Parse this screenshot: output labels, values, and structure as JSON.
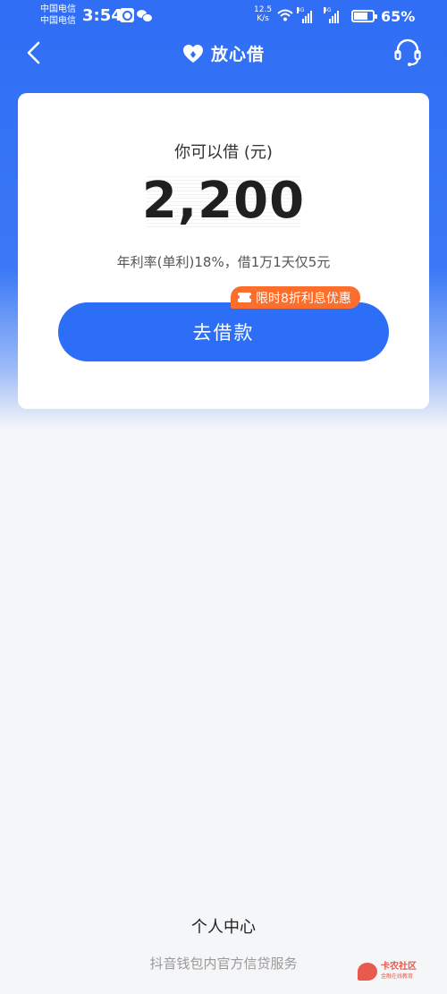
{
  "status_bar": {
    "carrier_1": "中国电信",
    "carrier_2": "中国电信",
    "time": "3:54",
    "net_speed_value": "12.5",
    "net_speed_unit": "K/s",
    "network_1": "4G",
    "network_2": "4G",
    "battery_percent": "65%"
  },
  "nav": {
    "title": "放心借"
  },
  "loan_card": {
    "label": "你可以借 (元)",
    "amount": "2,200",
    "rate_text": "年利率(单利)18%，借1万1天仅5元",
    "promo_badge": "限时8折利息优惠",
    "borrow_button": "去借款"
  },
  "footer": {
    "title": "个人中心",
    "subtitle": "抖音钱包内官方信贷服务"
  },
  "watermark": {
    "main": "卡农社区",
    "sub": "金融在线教育"
  },
  "colors": {
    "primary": "#2c6ef6",
    "promo": "#fd6d2b",
    "background": "#f5f6f8"
  }
}
